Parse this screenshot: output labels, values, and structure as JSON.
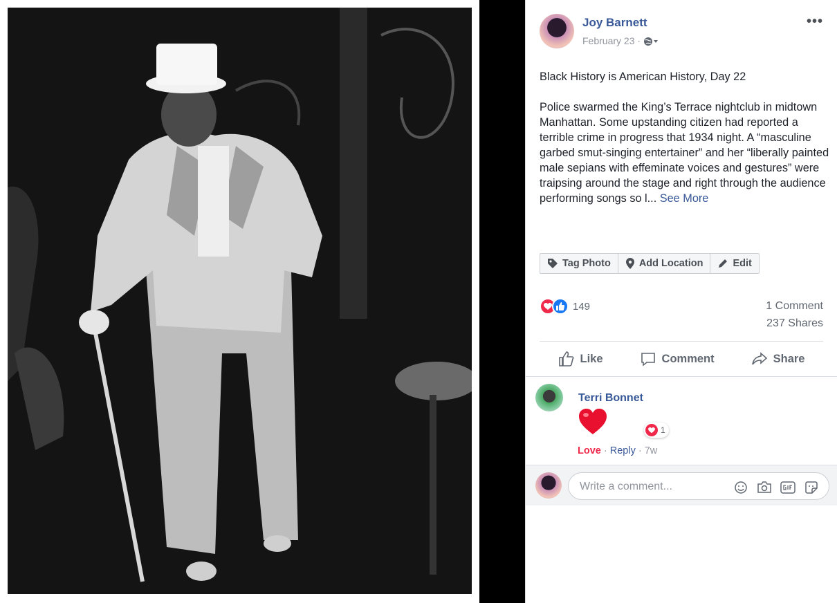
{
  "post": {
    "author": "Joy Barnett",
    "date": "February 23",
    "date_separator": "·",
    "more_label": "•••",
    "paragraph1": "Black History is American History, Day 22",
    "paragraph2": "Police swarmed the King’s Terrace nightclub in midtown Manhattan. Some upstanding citizen had reported a terrible crime in progress that 1934 night. A “masculine garbed smut-singing entertainer” and her “liberally painted male sepians with effeminate voices and gestures” were traipsing around the stage and right through the audience performing songs so l...",
    "see_more": "See More"
  },
  "toolbar": {
    "tag_photo": "Tag Photo",
    "add_location": "Add Location",
    "edit": "Edit"
  },
  "stats": {
    "reaction_count": "149",
    "comments": "1 Comment",
    "shares": "237 Shares"
  },
  "actions": {
    "like": "Like",
    "comment": "Comment",
    "share": "Share"
  },
  "comment": {
    "author": "Terri Bonnet",
    "reaction_count": "1",
    "love_label": "Love",
    "reply_label": "Reply",
    "age": "7w",
    "sep": "·"
  },
  "composer": {
    "placeholder": "Write a comment...",
    "icons": [
      "smiley-icon",
      "camera-icon",
      "gif-icon",
      "sticker-icon"
    ]
  },
  "colors": {
    "link": "#385898",
    "love": "#f0284a",
    "like": "#1877f2",
    "meta": "#90949c"
  }
}
